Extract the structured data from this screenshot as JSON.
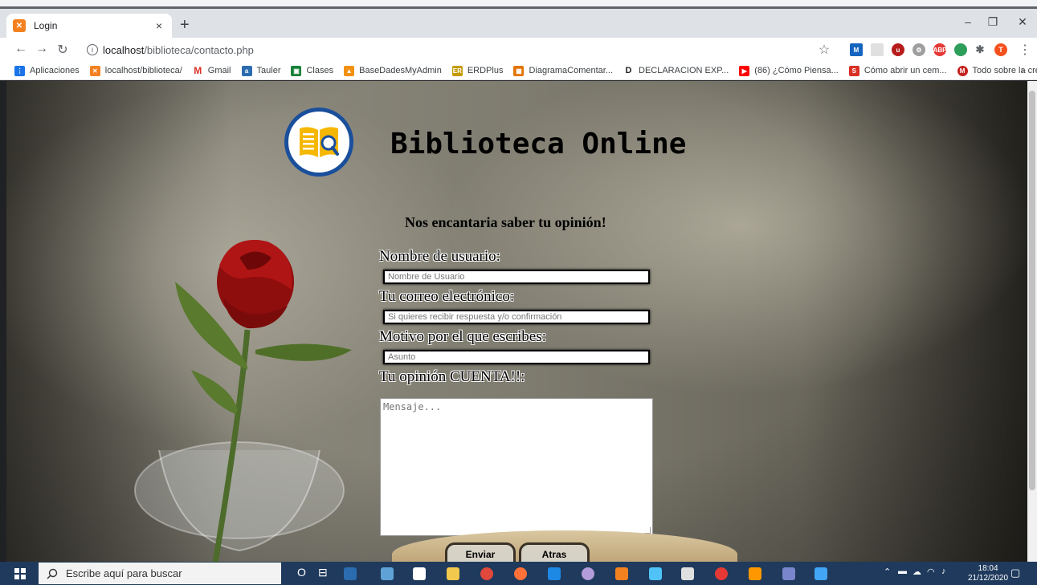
{
  "browser": {
    "tab_title": "Login",
    "tab_close": "×",
    "new_tab": "+",
    "url_host": "localhost",
    "url_path": "/biblioteca/contacto.php",
    "window_controls": [
      "–",
      "❐",
      "✕"
    ],
    "profile_initial": "T",
    "bookmarks_more": "»",
    "bookmarks": [
      {
        "label": "Aplicaciones",
        "icon": "apps-grid-icon",
        "color": "#1a73e8"
      },
      {
        "label": "localhost/biblioteca/",
        "icon": "xampp-icon",
        "color": "#f48120"
      },
      {
        "label": "Gmail",
        "icon": "gmail-icon",
        "color": "#d93025"
      },
      {
        "label": "Tauler",
        "icon": "tauler-icon",
        "color": "#2b6cb0"
      },
      {
        "label": "Clases",
        "icon": "classroom-icon",
        "color": "#188038"
      },
      {
        "label": "BaseDadesMyAdmin",
        "icon": "phpmyadmin-icon",
        "color": "#f29111"
      },
      {
        "label": "ERDPlus",
        "icon": "erdplus-icon",
        "color": "#c49a00"
      },
      {
        "label": "DiagramaComentar...",
        "icon": "diagram-icon",
        "color": "#e37400"
      },
      {
        "label": "DECLARACION EXP...",
        "icon": "document-icon",
        "color": "#202124"
      },
      {
        "label": "(86) ¿Cómo Piensa...",
        "icon": "youtube-icon",
        "color": "#ff0000"
      },
      {
        "label": "Cómo abrir un cem...",
        "icon": "site-icon",
        "color": "#d93025"
      },
      {
        "label": "Todo sobre la crem...",
        "icon": "site-m-icon",
        "color": "#c5221f"
      }
    ]
  },
  "page": {
    "site_title": "Biblioteca Online",
    "subtitle": "Nos encantaria saber tu opinión!",
    "username_label": "Nombre de usuario:",
    "username_placeholder": "Nombre de Usuario",
    "email_label": "Tu correo electrónico:",
    "email_placeholder": "Si quieres recibir respuesta y/o confirmación",
    "reason_label": "Motivo por el que escribes:",
    "reason_placeholder": "Asunto",
    "message_label": "Tu opinión CUENTA!!:",
    "message_placeholder": "Mensaje...",
    "send_button": "Enviar",
    "back_button": "Atras"
  },
  "taskbar": {
    "search_placeholder": "Escribe aquí para buscar",
    "time": "18:04",
    "date": "21/12/2020",
    "cortana_glyph": "O",
    "taskview_glyph": "⊟"
  },
  "colors": {
    "accent_blue": "#1a4f9c",
    "taskbar": "#1f3a5c"
  }
}
